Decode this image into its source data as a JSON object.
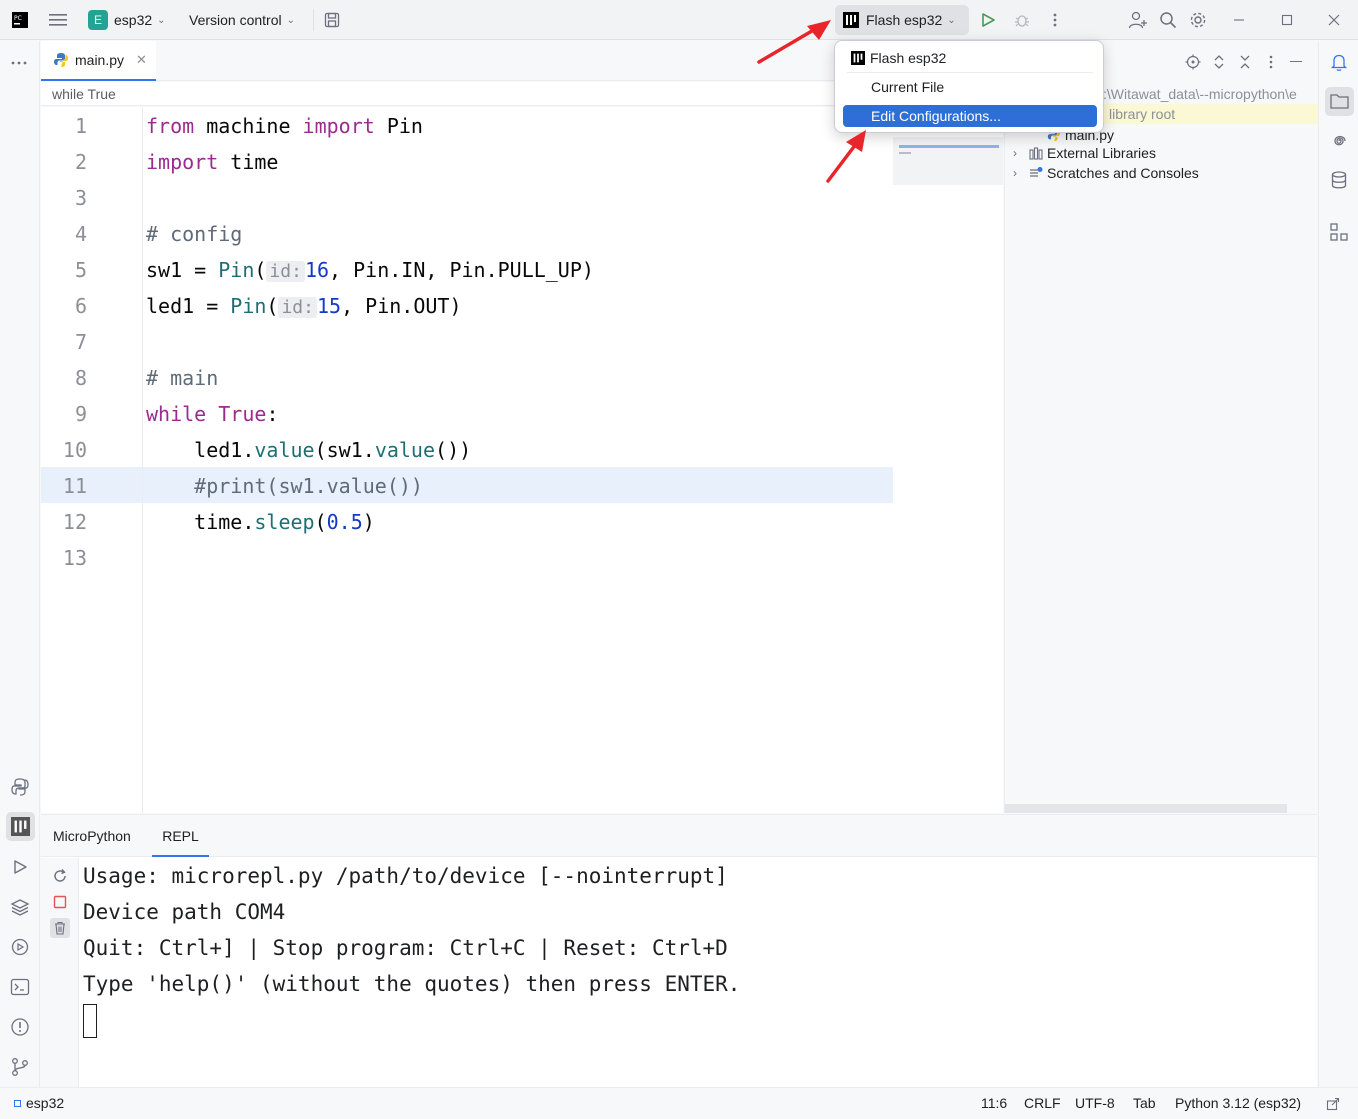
{
  "titlebar": {
    "project_badge": "E",
    "project_name": "esp32",
    "vcs_label": "Version control",
    "run_config": "Flash esp32"
  },
  "colors": {
    "accent": "#3574f0",
    "project_badge": "#24a394",
    "run_green": "#499c54",
    "arrow_red": "#e8252a",
    "selection": "#2d6fd6"
  },
  "editor": {
    "tab_label": "main.py",
    "breadcrumb": "while True",
    "line_numbers": [
      "1",
      "2",
      "3",
      "4",
      "5",
      "6",
      "7",
      "8",
      "9",
      "10",
      "11",
      "12",
      "13"
    ],
    "hint_id": "id:",
    "tokens": {
      "from": "from",
      "machine": " machine ",
      "import": "import",
      "Pin": " Pin",
      "import2": "import",
      "time": " time",
      "config": "# config",
      "sw1": "sw1 = ",
      "Pin1": "Pin",
      "paren1": "(",
      "n16": "16",
      "sw1rest": ", Pin.IN, Pin.PULL_UP)",
      "led1": "led1 = ",
      "Pin2": "Pin",
      "paren2": "(",
      "n15": "15",
      "led1rest": ", Pin.OUT)",
      "main": "# main",
      "while": "while",
      "True": " True",
      "colon": ":",
      "l10a": "    led1.",
      "l10b": "value",
      "l10c": "(sw1.",
      "l10d": "value",
      "l10e": "())",
      "l11": "    #print(sw1.value())",
      "l12a": "    time.",
      "l12b": "sleep",
      "l12c": "(",
      "l12d": "0.5",
      "l12e": ")"
    }
  },
  "project": {
    "path_fragment": ":\\Witawat_data\\--micropython\\e",
    "library_root": "library root",
    "main_file": "main.py",
    "external_libraries": "External Libraries",
    "scratches": "Scratches and Consoles"
  },
  "popup": {
    "items": [
      "Flash esp32",
      "Current File",
      "Edit Configurations..."
    ]
  },
  "bottom": {
    "tabs": [
      "MicroPython",
      "REPL"
    ],
    "repl_lines": [
      "Usage: microrepl.py /path/to/device [--nointerrupt]",
      "Device path COM4",
      "Quit: Ctrl+] | Stop program: Ctrl+C | Reset: Ctrl+D",
      "Type 'help()' (without the quotes) then press ENTER."
    ]
  },
  "statusbar": {
    "project": "esp32",
    "position": "11:6",
    "line_sep": "CRLF",
    "encoding": "UTF-8",
    "indent": "Tab",
    "interpreter": "Python 3.12 (esp32)"
  }
}
